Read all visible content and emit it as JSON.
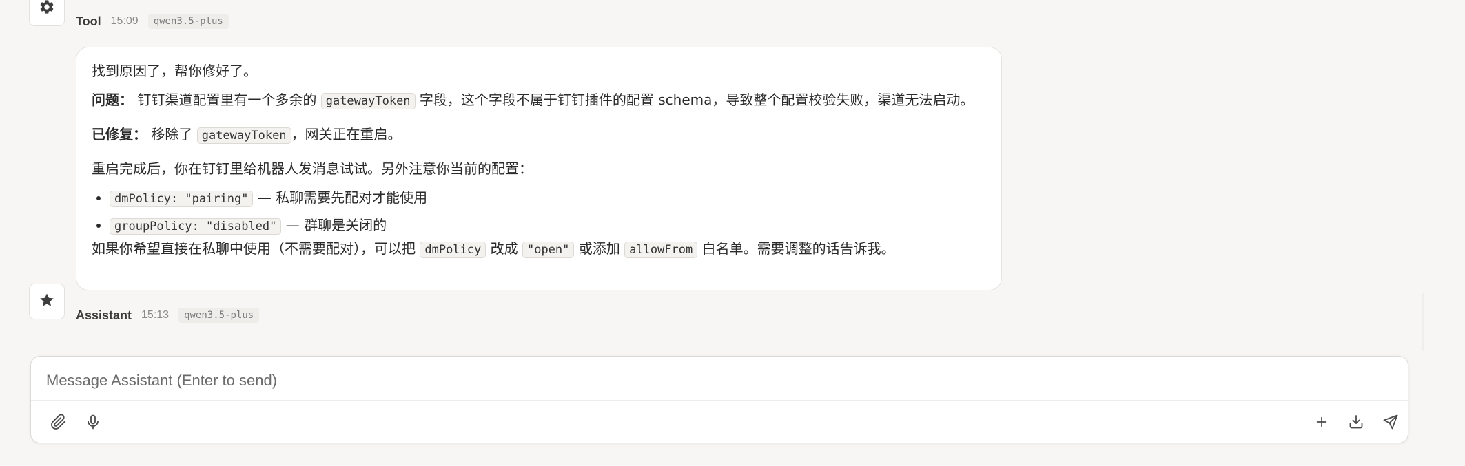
{
  "tool_message": {
    "sender": "Tool",
    "time": "15:09",
    "model": "qwen3.5-plus",
    "icon": "gear-icon",
    "content": {
      "intro": "找到原因了，帮你修好了。",
      "problem_label": "问题：",
      "problem_pre": "钉钉渠道配置里有一个多余的",
      "problem_code": "gatewayToken",
      "problem_post": "字段，这个字段不属于钉钉插件的配置 schema，导致整个配置校验失败，渠道无法启动。",
      "fixed_label": "已修复：",
      "fixed_pre": "移除了",
      "fixed_code": "gatewayToken",
      "fixed_post": "，网关正在重启。",
      "after_restart": "重启完成后，你在钉钉里给机器人发消息试试。另外注意你当前的配置：",
      "bullets": [
        {
          "code": "dmPolicy: \"pairing\"",
          "text": "— 私聊需要先配对才能使用"
        },
        {
          "code": "groupPolicy: \"disabled\"",
          "text": "— 群聊是关闭的"
        }
      ],
      "closing_pre": "如果你希望直接在私聊中使用（不需要配对），可以把",
      "closing_code1": "dmPolicy",
      "closing_mid1": "改成",
      "closing_code2": "\"open\"",
      "closing_mid2": "或添加",
      "closing_code3": "allowFrom",
      "closing_post": "白名单。需要调整的话告诉我。"
    }
  },
  "assistant_message": {
    "sender": "Assistant",
    "time": "15:13",
    "model": "qwen3.5-plus",
    "icon": "star-icon"
  },
  "composer": {
    "placeholder": "Message Assistant (Enter to send)",
    "value": "",
    "buttons": {
      "attach": "paperclip-icon",
      "mic": "microphone-icon",
      "new": "plus-icon",
      "download": "download-icon",
      "send": "send-icon"
    }
  },
  "colors": {
    "background": "#f7f6f4",
    "bubble": "#ffffff",
    "code_bg": "#f3f2ef",
    "text": "#2b2b2b",
    "muted": "#8a8a8a"
  }
}
